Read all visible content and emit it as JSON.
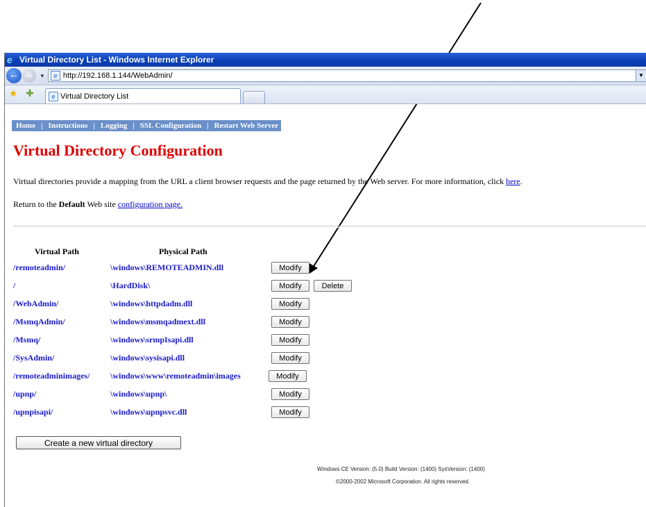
{
  "window": {
    "title": "Virtual Directory List - Windows Internet Explorer"
  },
  "address": {
    "url": "http://192.168.1.144/WebAdmin/"
  },
  "tab": {
    "label": "Virtual Directory List"
  },
  "nav": {
    "items": [
      "Home",
      "Instructions",
      "Logging",
      "SSL Configuration",
      "Restart Web Server"
    ],
    "separator": "|"
  },
  "page": {
    "title": "Virtual Directory Configuration",
    "intro_text": "Virtual directories provide a mapping from the URL a client browser requests and the page returned by the Web server. For more information, click ",
    "intro_link": "here",
    "intro_end": ".",
    "return_pre": "Return to the ",
    "return_bold": "Default",
    "return_mid": " Web site ",
    "return_link": "configuration page."
  },
  "table": {
    "headers": [
      "Virtual Path",
      "Physical Path"
    ],
    "rows": [
      {
        "virtual": "/remoteadmin/",
        "physical": "\\windows\\REMOTEADMIN.dll",
        "actions": [
          "Modify"
        ]
      },
      {
        "virtual": "/",
        "physical": "\\HardDisk\\",
        "actions": [
          "Modify",
          "Delete"
        ]
      },
      {
        "virtual": "/WebAdmin/",
        "physical": "\\windows\\httpdadm.dll",
        "actions": [
          "Modify"
        ]
      },
      {
        "virtual": "/MsmqAdmin/",
        "physical": "\\windows\\msmqadmext.dll",
        "actions": [
          "Modify"
        ]
      },
      {
        "virtual": "/Msmq/",
        "physical": "\\windows\\srmpIsapi.dll",
        "actions": [
          "Modify"
        ]
      },
      {
        "virtual": "/SysAdmin/",
        "physical": "\\windows\\sysisapi.dll",
        "actions": [
          "Modify"
        ]
      },
      {
        "virtual": "/remoteadminimages/",
        "physical": "\\windows\\www\\remoteadmin\\images",
        "actions": [
          "Modify"
        ]
      },
      {
        "virtual": "/upnp/",
        "physical": "\\windows\\upnp\\",
        "actions": [
          "Modify"
        ]
      },
      {
        "virtual": "/upnpisapi/",
        "physical": "\\windows\\upnpsvc.dll",
        "actions": [
          "Modify"
        ]
      }
    ]
  },
  "create_button": "Create a new virtual directory",
  "footer": {
    "line1": "Windows CE Version: (5.0) Build Version: (1400) SysVersion: (1400)",
    "line2": "©2000-2002 Microsoft Corporation. All rights reserved."
  },
  "colors": {
    "title_red": "#e00000",
    "link_blue": "#1a1acc",
    "nav_bg": "#6a8fc9",
    "titlebar_blue": "#0a3fb5"
  }
}
